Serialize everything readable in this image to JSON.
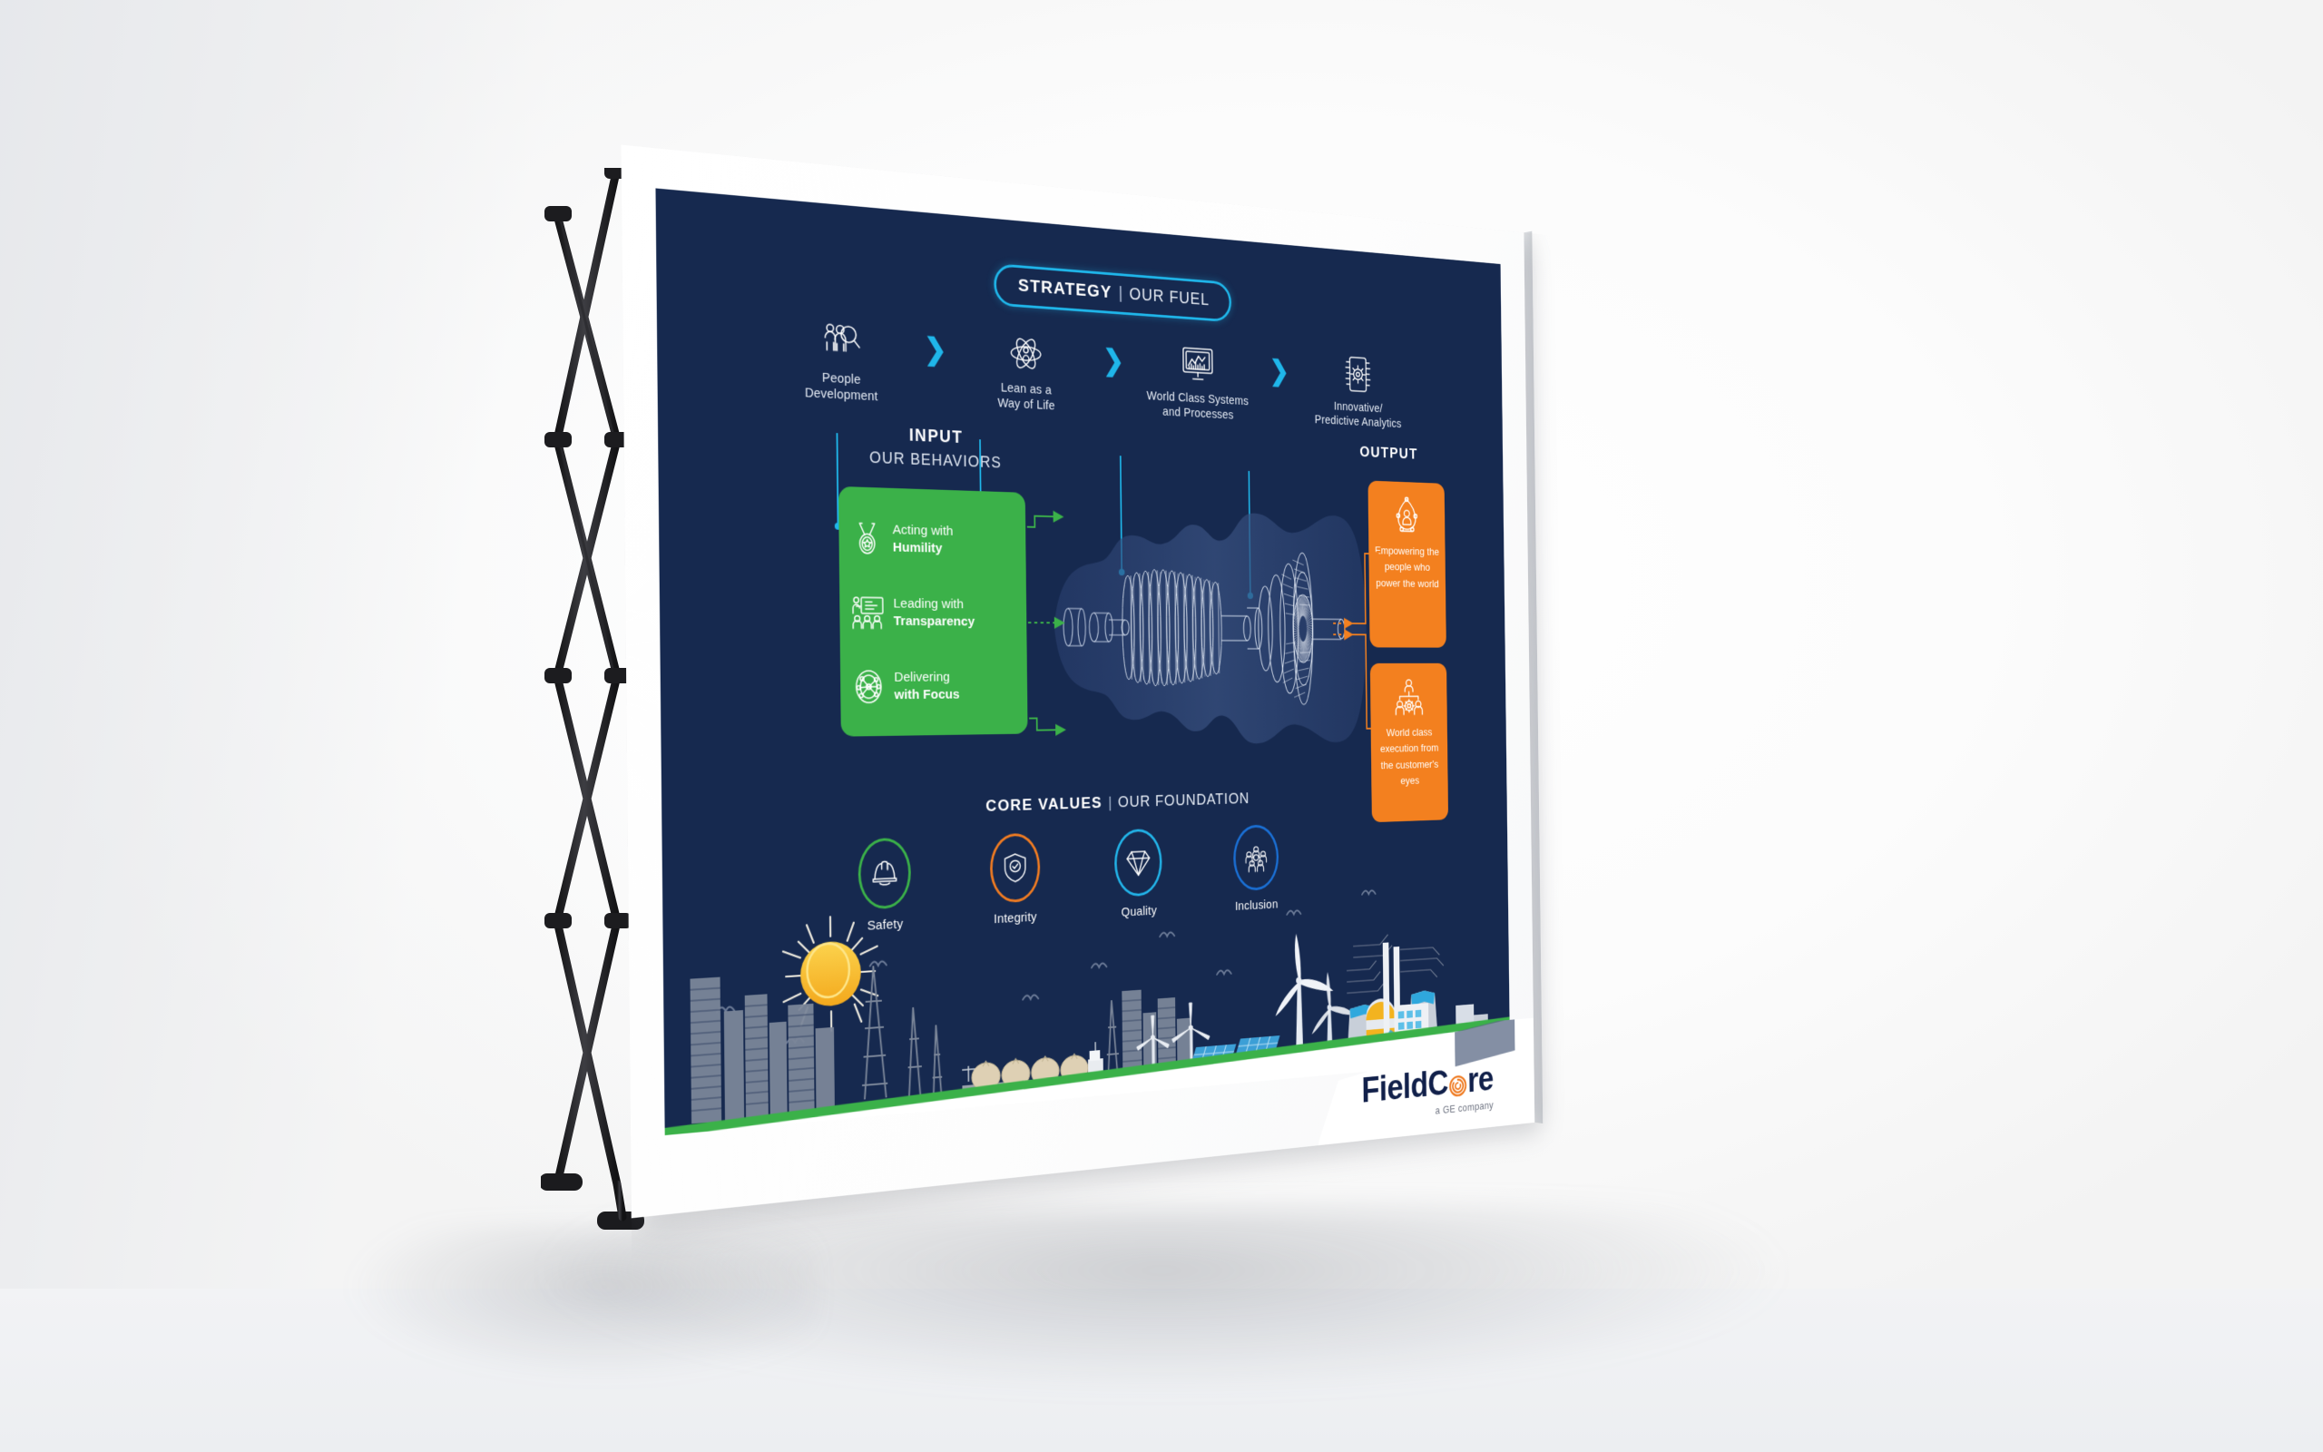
{
  "scene": {
    "type": "trade-show-popup-banner",
    "background_color": "#f4f5f7",
    "frame_color": "#ffffff",
    "stand_color": "#202023"
  },
  "banner": {
    "panel_color": "#16294f",
    "accent_cyan": "#1fb6ea",
    "accent_green": "#3bb149",
    "accent_orange": "#f3801f",
    "strategy": {
      "title_bold": "STRATEGY",
      "title_sep": "|",
      "title_rest": "OUR FUEL",
      "chevron": "❯",
      "items": [
        {
          "label_line1": "People",
          "label_line2": "Development",
          "icon": "people-search-icon"
        },
        {
          "label_line1": "Lean as a",
          "label_line2": "Way of Life",
          "icon": "atom-person-icon"
        },
        {
          "label_line1": "World Class Systems",
          "label_line2": "and Processes",
          "icon": "monitor-chart-icon"
        },
        {
          "label_line1": "Innovative/",
          "label_line2": "Predictive Analytics",
          "icon": "mobile-gear-icon"
        }
      ]
    },
    "input": {
      "title": "INPUT",
      "subtitle": "OUR BEHAVIORS",
      "behaviors": [
        {
          "lead": "Acting with",
          "bold": "Humility",
          "icon": "medal-icon"
        },
        {
          "lead": "Leading with",
          "bold": "Transparency",
          "icon": "presentation-audience-icon"
        },
        {
          "lead": "Delivering",
          "bold": "with Focus",
          "icon": "target-network-icon"
        }
      ]
    },
    "output": {
      "title": "OUTPUT",
      "cards": [
        {
          "text": "Empowering the people who power the world",
          "icon": "lightbulb-person-icon"
        },
        {
          "text": "World class execution from the customer's eyes",
          "icon": "team-gear-icon"
        }
      ]
    },
    "core_values": {
      "title_bold": "CORE VALUES",
      "title_sep": "|",
      "title_rest": "OUR FOUNDATION",
      "items": [
        {
          "label": "Safety",
          "icon": "hard-hat-icon",
          "ring_color": "#3bb149"
        },
        {
          "label": "Integrity",
          "icon": "shield-check-icon",
          "ring_color": "#ef7b22"
        },
        {
          "label": "Quality",
          "icon": "diamond-icon",
          "ring_color": "#22b3e8"
        },
        {
          "label": "Inclusion",
          "icon": "people-group-icon",
          "ring_color": "#1a6fd4"
        }
      ]
    },
    "center_graphic": {
      "name": "gas-turbine-cutaway-illustration"
    },
    "footer_scene": {
      "name": "energy-skyline-illustration",
      "elements": [
        "city-skyline",
        "sun",
        "lng-tanker-ship",
        "wind-turbine",
        "solar-panel-array",
        "power-plant",
        "birds"
      ]
    },
    "logo": {
      "word_1": "Field",
      "word_2": "C",
      "word_3": "re",
      "tagline": "a GE company",
      "mark": "orange-core-swirl-icon"
    }
  }
}
